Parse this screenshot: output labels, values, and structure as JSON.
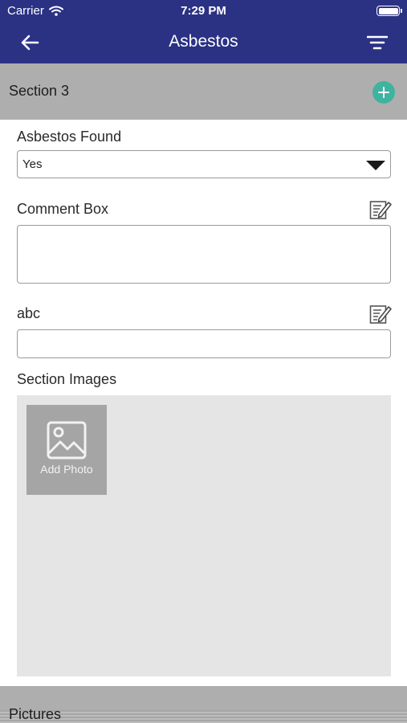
{
  "status_bar": {
    "carrier": "Carrier",
    "time": "7:29 PM"
  },
  "nav": {
    "title": "Asbestos",
    "back_icon": "arrow-left-icon",
    "filter_icon": "filter-icon"
  },
  "section": {
    "title": "Section 3",
    "add_icon": "plus-circle-icon"
  },
  "fields": {
    "asbestos_found": {
      "label": "Asbestos Found",
      "value": "Yes"
    },
    "comment_box": {
      "label": "Comment Box",
      "value": ""
    },
    "abc": {
      "label": "abc",
      "value": ""
    }
  },
  "images": {
    "label": "Section Images",
    "add_photo_label": "Add Photo"
  },
  "next_section": {
    "title": "Pictures"
  },
  "colors": {
    "nav_bg": "#2b3284",
    "section_bg": "#aeaeae",
    "accent": "#3fb39f"
  }
}
